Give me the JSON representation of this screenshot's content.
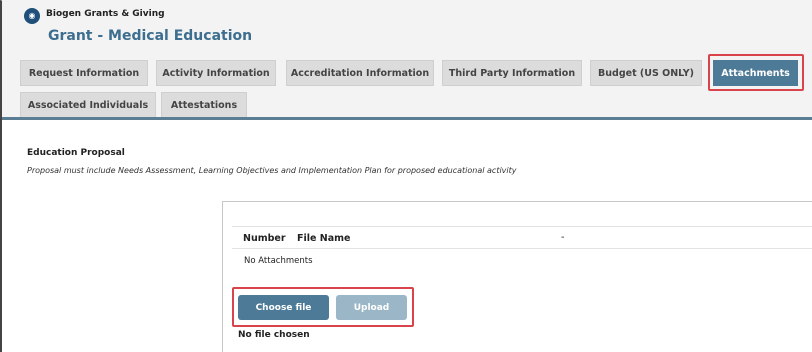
{
  "header": {
    "brand_name": "Biogen Grants & Giving",
    "page_title": "Grant - Medical Education"
  },
  "tabs": [
    {
      "label": "Request Information",
      "active": false
    },
    {
      "label": "Activity Information",
      "active": false
    },
    {
      "label": "Accreditation Information",
      "active": false
    },
    {
      "label": "Third Party Information",
      "active": false
    },
    {
      "label": "Budget (US ONLY)",
      "active": false
    },
    {
      "label": "Attachments",
      "active": true
    },
    {
      "label": "Associated Individuals",
      "active": false
    },
    {
      "label": "Attestations",
      "active": false
    }
  ],
  "section": {
    "title": "Education Proposal",
    "description": "Proposal must include Needs Assessment, Learning Objectives and Implementation Plan for proposed educational activity"
  },
  "attachments_table": {
    "columns": [
      "Number",
      "File Name",
      "-"
    ],
    "empty_text": "No Attachments"
  },
  "upload": {
    "choose_label": "Choose file",
    "upload_label": "Upload",
    "status_text": "No file chosen"
  },
  "colors": {
    "accent": "#4d7a96",
    "highlight": "#d9434c",
    "title": "#3d6e8f"
  }
}
